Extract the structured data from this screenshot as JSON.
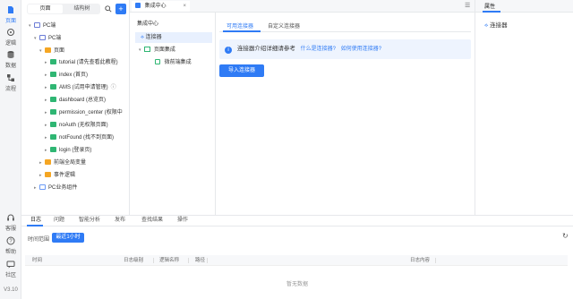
{
  "rail": {
    "items": [
      {
        "label": "页面",
        "icon": "page-icon",
        "active": true
      },
      {
        "label": "逻辑",
        "icon": "logic-icon"
      },
      {
        "label": "数据",
        "icon": "database-icon"
      },
      {
        "label": "流程",
        "icon": "flow-icon"
      }
    ],
    "bottom": [
      {
        "label": "客服",
        "icon": "headset-icon"
      },
      {
        "label": "帮助",
        "icon": "help-icon"
      },
      {
        "label": "社区",
        "icon": "community-icon"
      }
    ],
    "version": "V3.10"
  },
  "tree": {
    "tab_page": "页面",
    "tab_structure": "结构树",
    "rows": [
      {
        "label": "PC端",
        "icon": "pc",
        "arrow": "▾"
      },
      {
        "label": "PC端",
        "icon": "pc",
        "arrow": "▾"
      },
      {
        "label": "页面",
        "icon": "folder",
        "arrow": "▾"
      },
      {
        "label": "tutorial (请先查看此教程)",
        "icon": "page",
        "arrow": "▸"
      },
      {
        "label": "index (首页)",
        "icon": "page",
        "arrow": "▸"
      },
      {
        "label": "AMS (试用申请管理)",
        "icon": "page",
        "arrow": "▸",
        "note": "ⓘ"
      },
      {
        "label": "dashboard (总览页)",
        "icon": "page",
        "arrow": "▸"
      },
      {
        "label": "permission_center (权限中",
        "icon": "page",
        "arrow": "▸"
      },
      {
        "label": "noAuth (无权限页面)",
        "icon": "page",
        "arrow": "▸"
      },
      {
        "label": "notFound (找不到页面)",
        "icon": "page",
        "arrow": "▸"
      },
      {
        "label": "login (登录页)",
        "icon": "page",
        "arrow": "▸"
      },
      {
        "label": "前端全局变量",
        "icon": "folder",
        "arrow": "▸"
      },
      {
        "label": "事件逻辑",
        "icon": "folder",
        "arrow": "▸"
      },
      {
        "label": "PC业务组件",
        "icon": "sub",
        "arrow": "▸"
      }
    ]
  },
  "topbar": {
    "tab_label": "集成中心",
    "close": "×",
    "menu": "☰",
    "props_tab": "属性"
  },
  "integration": {
    "title": "集成中心",
    "rows": [
      {
        "label": "连接器",
        "selected": true
      },
      {
        "label": "页面集成"
      },
      {
        "label": "微前端集成"
      }
    ]
  },
  "main": {
    "tab_available": "可用连接器",
    "tab_custom": "自定义连接器",
    "info_text": "连接器介绍详细请参考",
    "link_what": "什么是连接器?",
    "link_how": "如何使用连接器?",
    "import_button": "导入连接器"
  },
  "props": {
    "item_label": "连接器"
  },
  "console": {
    "tabs": [
      "日志",
      "问题",
      "智能分析",
      "发布",
      "查找结果",
      "操作"
    ],
    "time_range_label": "时间范围",
    "time_range_value": "最近1小时",
    "columns": [
      "时间",
      "日志级别",
      "逻辑名称",
      "路径",
      "日志内容"
    ],
    "empty_text": "暂无数据"
  },
  "colors": {
    "accent": "#2f7bf5"
  }
}
